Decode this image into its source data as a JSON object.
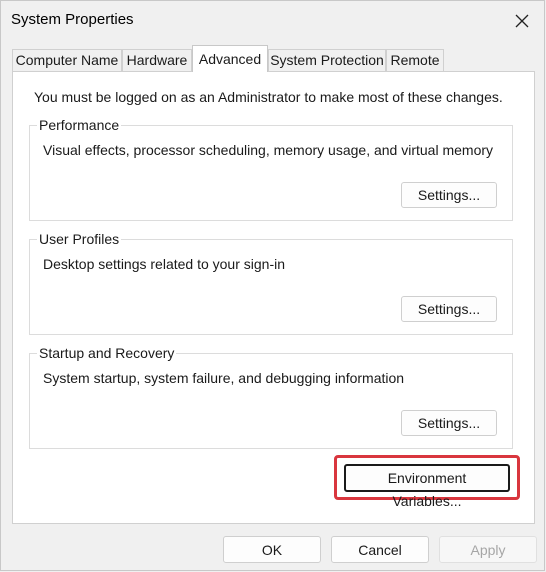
{
  "window": {
    "title": "System Properties"
  },
  "tabs": [
    {
      "label": "Computer Name"
    },
    {
      "label": "Hardware"
    },
    {
      "label": "Advanced"
    },
    {
      "label": "System Protection"
    },
    {
      "label": "Remote"
    }
  ],
  "active_tab": "Advanced",
  "intro_text": "You must be logged on as an Administrator to make most of these changes.",
  "groups": {
    "performance": {
      "title": "Performance",
      "description": "Visual effects, processor scheduling, memory usage, and virtual memory",
      "button_label": "Settings..."
    },
    "user_profiles": {
      "title": "User Profiles",
      "description": "Desktop settings related to your sign-in",
      "button_label": "Settings..."
    },
    "startup_recovery": {
      "title": "Startup and Recovery",
      "description": "System startup, system failure, and debugging information",
      "button_label": "Settings..."
    }
  },
  "env_button_label": "Environment Variables...",
  "footer": {
    "ok": "OK",
    "cancel": "Cancel",
    "apply": "Apply"
  },
  "colors": {
    "highlight": "#d9363e",
    "background": "#f0f0f0",
    "panel": "#ffffff"
  },
  "icons": {
    "close": "close-icon"
  }
}
